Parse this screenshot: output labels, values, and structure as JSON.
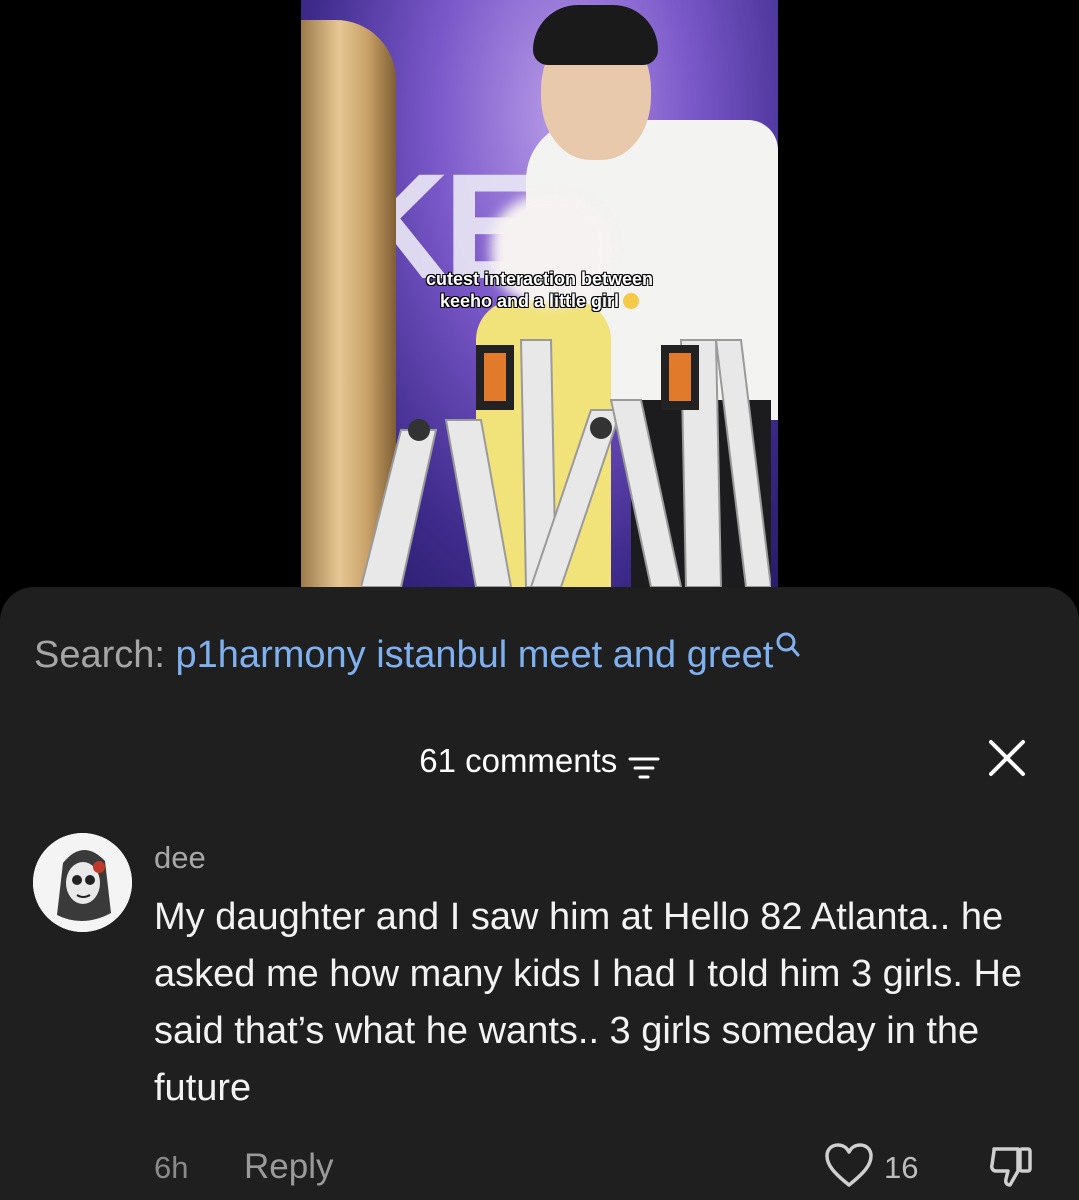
{
  "video": {
    "caption_line1": "cutest interaction between",
    "caption_line2": "keeho and a little girl"
  },
  "search": {
    "label": "Search:",
    "query": "p1harmony istanbul meet and greet"
  },
  "comments_header": {
    "count_label": "61 comments"
  },
  "comment": {
    "username": "dee",
    "text": "My daughter and I saw him at Hello 82 Atlanta.. he asked me how many kids I had I told him 3 girls. He said that’s what he wants.. 3 girls someday in the future",
    "time": "6h",
    "reply_label": "Reply",
    "like_count": "16"
  },
  "icons": {
    "search": "search-icon",
    "filter": "filter-icon",
    "close": "close-icon",
    "like": "heart-icon",
    "dislike": "thumbs-down-icon"
  },
  "colors": {
    "sheet_bg": "#1f1f1f",
    "search_query": "#7fb1f0",
    "muted_text": "#a8a8a8"
  }
}
